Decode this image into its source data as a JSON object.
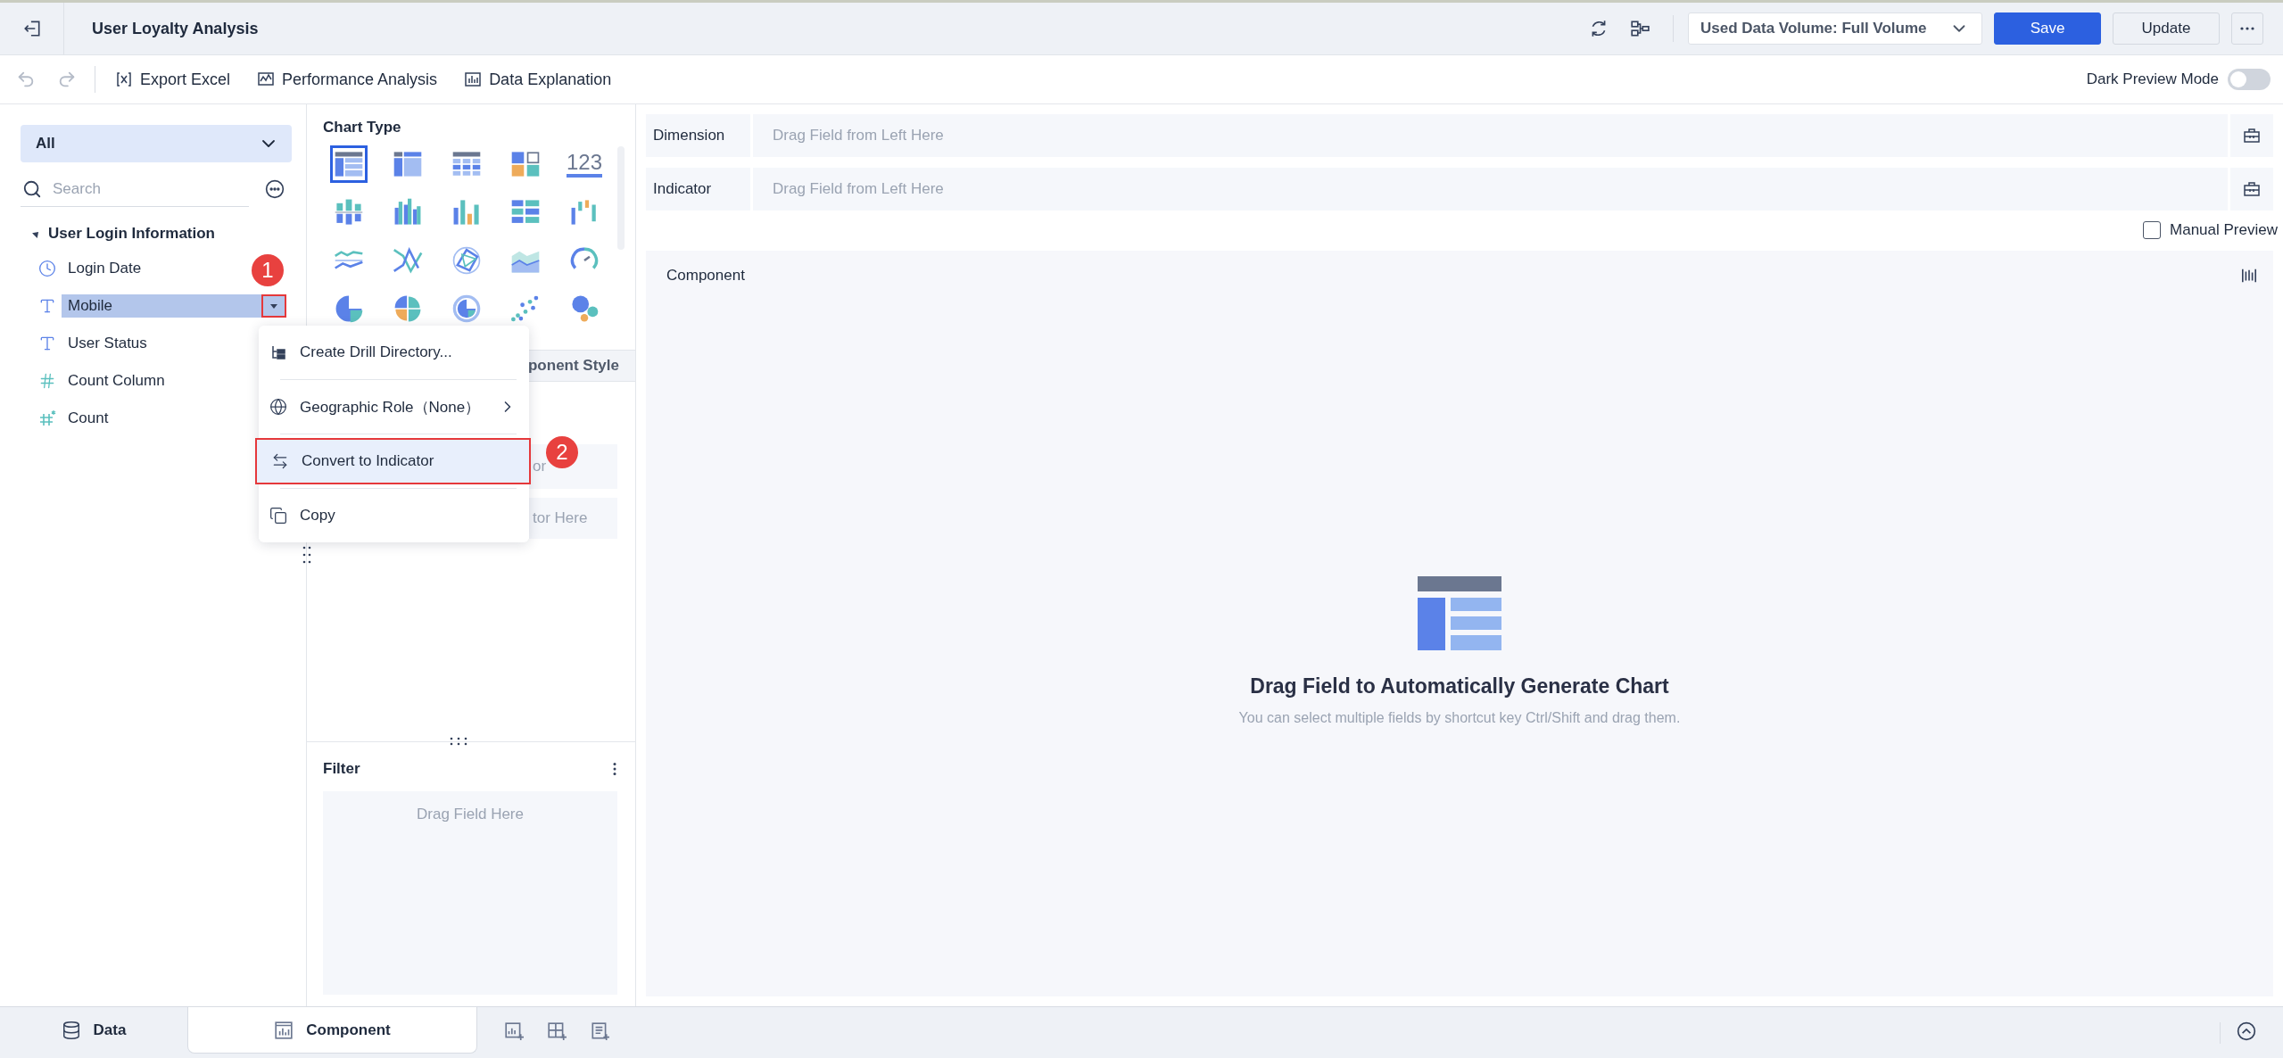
{
  "header": {
    "title": "User Loyalty Analysis",
    "data_volume": "Used Data Volume: Full Volume",
    "buttons": [
      {
        "label": "Save",
        "kind": "primary"
      },
      {
        "label": "Update",
        "kind": "default"
      }
    ]
  },
  "toolbar": {
    "actions": [
      {
        "label": "Export Excel",
        "kind": "excel"
      },
      {
        "label": "Performance Analysis",
        "kind": "performance"
      },
      {
        "label": "Data Explanation",
        "kind": "explanation"
      }
    ],
    "dark_preview": {
      "label": "Dark Preview Mode",
      "on": false
    }
  },
  "sidebar": {
    "scope": "All",
    "search": {
      "placeholder": "Search"
    },
    "group": {
      "label": "User Login Information",
      "expanded": true,
      "children": [
        {
          "label": "Login Date",
          "kind": "date",
          "selected": false
        },
        {
          "label": "Mobile",
          "kind": "text",
          "selected": true
        },
        {
          "label": "User Status",
          "kind": "text",
          "selected": false
        },
        {
          "label": "Count Column",
          "kind": "number",
          "selected": false
        },
        {
          "label": "Count",
          "kind": "calc",
          "selected": false
        }
      ]
    }
  },
  "context_menu": {
    "items": [
      {
        "label": "Create Drill Directory...",
        "kind": "drill",
        "selected": false,
        "submenu": false
      },
      {
        "label": "Geographic Role（None）",
        "kind": "geo",
        "selected": false,
        "submenu": true
      },
      {
        "label": "Convert to Indicator",
        "kind": "convert",
        "selected": true,
        "submenu": false
      },
      {
        "label": "Copy",
        "kind": "copy",
        "selected": false,
        "submenu": false
      }
    ]
  },
  "chart_panel": {
    "title": "Chart Type",
    "chart_types": [
      {
        "kind": "table",
        "selected": true
      },
      {
        "kind": "cross-table",
        "selected": false
      },
      {
        "kind": "detail-table",
        "selected": false
      },
      {
        "kind": "cards",
        "selected": false
      },
      {
        "kind": "number",
        "label": "123",
        "selected": false
      },
      {
        "kind": "stacked-bar",
        "selected": false
      },
      {
        "kind": "grouped-bar",
        "selected": false
      },
      {
        "kind": "bar",
        "selected": false
      },
      {
        "kind": "split-bar",
        "selected": false
      },
      {
        "kind": "waterfall",
        "selected": false
      },
      {
        "kind": "line",
        "selected": false
      },
      {
        "kind": "cross-line",
        "selected": false
      },
      {
        "kind": "radar",
        "selected": false
      },
      {
        "kind": "area",
        "selected": false
      },
      {
        "kind": "gauge",
        "selected": false
      },
      {
        "kind": "pie",
        "selected": false
      },
      {
        "kind": "rose",
        "selected": false
      },
      {
        "kind": "donut",
        "selected": false
      },
      {
        "kind": "scatter",
        "selected": false
      },
      {
        "kind": "bubble",
        "selected": false
      }
    ],
    "config_tab": {
      "label": "ponent Style",
      "selected": false
    },
    "shelves": [
      {
        "hint": "or"
      },
      {
        "hint": "tor Here"
      }
    ],
    "filter": {
      "title": "Filter",
      "hint": "Drag Field Here"
    }
  },
  "editor": {
    "shelves": [
      {
        "label": "Dimension",
        "hint": "Drag Field from Left Here"
      },
      {
        "label": "Indicator",
        "hint": "Drag Field from Left Here"
      }
    ],
    "manual_preview": {
      "label": "Manual Preview",
      "checked": false
    },
    "component": {
      "title": "Component",
      "empty_title": "Drag Field to Automatically Generate Chart",
      "empty_hint": "You can select multiple fields by shortcut key Ctrl/Shift and drag them."
    }
  },
  "bottom_tabs": [
    {
      "label": "Data",
      "kind": "data",
      "selected": false
    },
    {
      "label": "Component",
      "kind": "component",
      "selected": true
    }
  ],
  "annotations": [
    {
      "label": "1"
    },
    {
      "label": "2"
    }
  ]
}
